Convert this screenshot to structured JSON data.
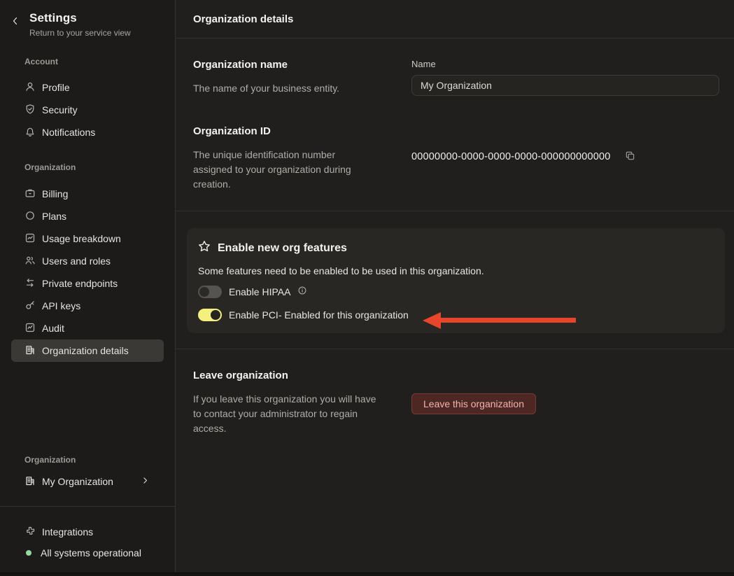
{
  "sidebar": {
    "title": "Settings",
    "subtitle": "Return to your service view",
    "sections": [
      {
        "label": "Account",
        "items": [
          {
            "label": "Profile",
            "icon": "user-icon"
          },
          {
            "label": "Security",
            "icon": "shield-check-icon"
          },
          {
            "label": "Notifications",
            "icon": "bell-icon"
          }
        ]
      },
      {
        "label": "Organization",
        "items": [
          {
            "label": "Billing",
            "icon": "billing-icon"
          },
          {
            "label": "Plans",
            "icon": "circle-icon"
          },
          {
            "label": "Usage breakdown",
            "icon": "chart-icon"
          },
          {
            "label": "Users and roles",
            "icon": "users-icon"
          },
          {
            "label": "Private endpoints",
            "icon": "swap-arrows-icon"
          },
          {
            "label": "API keys",
            "icon": "key-icon"
          },
          {
            "label": "Audit",
            "icon": "activity-icon"
          },
          {
            "label": "Organization details",
            "icon": "building-icon",
            "selected": true
          }
        ]
      }
    ],
    "bottom": {
      "section_label": "Organization",
      "org_name": "My Organization",
      "integrations_label": "Integrations",
      "status_label": "All systems operational"
    }
  },
  "main": {
    "header": "Organization details",
    "org_name_section": {
      "title": "Organization name",
      "description": "The name of your business entity.",
      "field_label": "Name",
      "field_value": "My Organization"
    },
    "org_id_section": {
      "title": "Organization ID",
      "description": "The unique identification number assigned to your organization during creation.",
      "org_id": "00000000-0000-0000-0000-000000000000"
    },
    "features_card": {
      "title": "Enable new org features",
      "description": "Some features need to be enabled to be used in this organization.",
      "toggles": [
        {
          "label": "Enable HIPAA",
          "state": "off",
          "has_info": true
        },
        {
          "label": "Enable PCI- Enabled for this organization",
          "state": "on"
        }
      ]
    },
    "leave_section": {
      "title": "Leave organization",
      "description": "If you leave this organization you will have to contact your administrator to regain access.",
      "button_label": "Leave this organization"
    }
  },
  "colors": {
    "toggle_on": "#f5f07e",
    "toggle_off": "#56544f",
    "arrow_red": "#e8462a",
    "status_green": "#90d9a0",
    "danger_button_bg": "#4c2723",
    "danger_button_text": "#f1b4ad",
    "card_bg": "#282724",
    "sidebar_selected": "#3b3936"
  }
}
